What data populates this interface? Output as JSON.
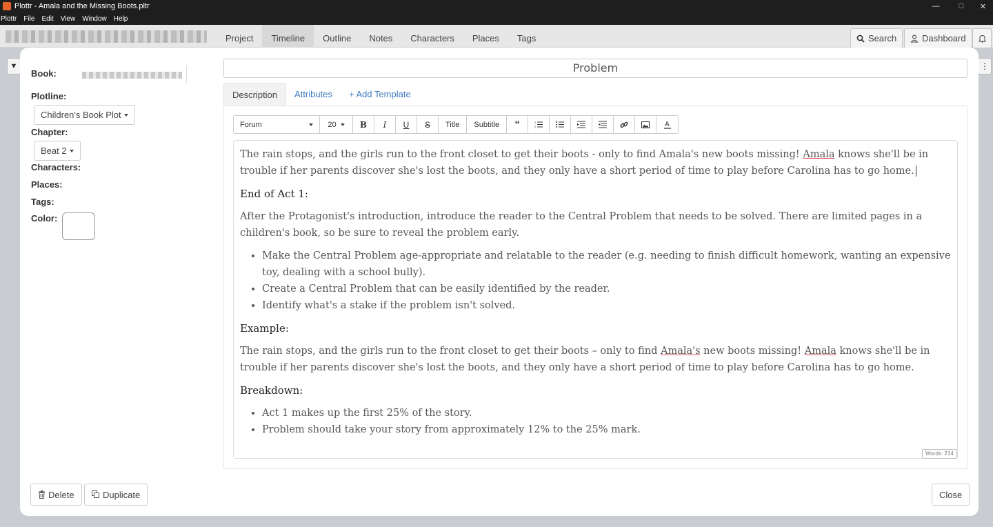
{
  "window": {
    "title": "Plottr - Amala and the Missing Boots.pltr"
  },
  "menu": [
    "Plottr",
    "File",
    "Edit",
    "View",
    "Window",
    "Help"
  ],
  "nav": {
    "tabs": [
      "Project",
      "Timeline",
      "Outline",
      "Notes",
      "Characters",
      "Places",
      "Tags"
    ],
    "active_tab": "Timeline",
    "search_label": "Search",
    "dashboard_label": "Dashboard"
  },
  "sidebar": {
    "book_label": "Book:",
    "plotline_label": "Plotline:",
    "plotline_value": "Children's Book Plot",
    "chapter_label": "Chapter:",
    "chapter_value": "Beat 2",
    "characters_label": "Characters:",
    "places_label": "Places:",
    "tags_label": "Tags:",
    "color_label": "Color:"
  },
  "card": {
    "title": "Problem",
    "tabs": {
      "description": "Description",
      "attributes": "Attributes",
      "add_template": "+ Add Template"
    }
  },
  "toolbar": {
    "font": "Forum",
    "size": "20",
    "title_btn": "Title",
    "subtitle_btn": "Subtitle"
  },
  "content": {
    "p1": "The rain stops, and the girls run to the front closet to get their boots - only to find Amala's new boots missing! ",
    "p1_amala": "Amala",
    "p1_rest": " knows she'll be in trouble if her parents discover she's lost the boots, and they only have a short period of time to play before Carolina has to go home.",
    "h_end_act": "End of Act 1:",
    "p2": "After the Protagonist's introduction, introduce the reader to the Central Problem that needs to be solved. There are limited pages in a children's book, so be sure to reveal the problem early.",
    "list1": [
      "Make the Central Problem age-appropriate and relatable to the reader (e.g. needing to finish difficult homework, wanting an expensive toy, dealing with a school bully).",
      "Create a Central Problem that can be easily identified by the reader.",
      "Identify what's a stake if the problem isn't solved."
    ],
    "h_example": "Example:",
    "ex_a": "The rain stops, and the girls run to the front closet to get their boots – only to find ",
    "ex_amalas": "Amala's",
    "ex_b": " new boots missing! ",
    "ex_amala": "Amala",
    "ex_c": " knows she'll be in trouble if her parents discover she's lost the boots, and they only have a short period of time to play before Carolina has to go home.",
    "h_breakdown": "Breakdown:",
    "list2": [
      "Act 1 makes up the first 25% of the story.",
      "Problem should take your story from approximately 12% to the 25% mark."
    ],
    "word_count": "Words: 214"
  },
  "footer": {
    "delete_label": "Delete",
    "duplicate_label": "Duplicate",
    "close_label": "Close"
  },
  "colors": {
    "accent": "#3c7abf",
    "titlebar": "#1e1e1e",
    "spellcheck": "#e04a4a"
  }
}
